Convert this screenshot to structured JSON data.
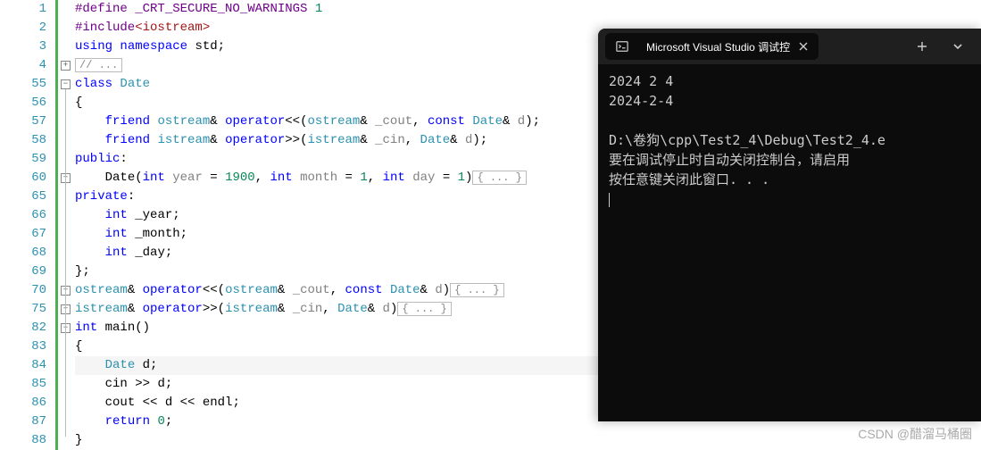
{
  "lines": [
    {
      "n": 1,
      "fold": "",
      "html": "<span class='def'>#define</span> <span class='def'>_CRT_SECURE_NO_WARNINGS</span> <span class='num'>1</span>"
    },
    {
      "n": 2,
      "fold": "",
      "html": "<span class='def'>#include</span><span class='str'>&lt;iostream&gt;</span>"
    },
    {
      "n": 3,
      "fold": "",
      "html": "<span class='kw'>using</span> <span class='kw'>namespace</span> <span class='id'>std</span>;"
    },
    {
      "n": 4,
      "fold": "plus",
      "html": "<span class='collapsed-box'>// ...</span>"
    },
    {
      "n": 55,
      "fold": "minus",
      "html": "<span class='kw'>class</span> <span class='type'>Date</span>"
    },
    {
      "n": 56,
      "fold": "",
      "html": "{"
    },
    {
      "n": 57,
      "fold": "",
      "html": "    <span class='kw'>friend</span> <span class='type'>ostream</span>&amp; <span class='kw'>operator</span>&lt;&lt;(<span class='type'>ostream</span>&amp; <span class='param'>_cout</span>, <span class='kw'>const</span> <span class='type'>Date</span>&amp; <span class='param'>d</span>);"
    },
    {
      "n": 58,
      "fold": "",
      "html": "    <span class='kw'>friend</span> <span class='type'>istream</span>&amp; <span class='kw'>operator</span>&gt;&gt;(<span class='type'>istream</span>&amp; <span class='param'>_cin</span>, <span class='type'>Date</span>&amp; <span class='param'>d</span>);"
    },
    {
      "n": 59,
      "fold": "",
      "html": "<span class='kw'>public</span>:"
    },
    {
      "n": 60,
      "fold": "plus",
      "html": "    <span class='id'>Date</span>(<span class='kw'>int</span> <span class='param'>year</span> = <span class='num'>1900</span>, <span class='kw'>int</span> <span class='param'>month</span> = <span class='num'>1</span>, <span class='kw'>int</span> <span class='param'>day</span> = <span class='num'>1</span>)<span class='collapsed-box'>{ ... }</span>"
    },
    {
      "n": 65,
      "fold": "",
      "html": "<span class='kw'>private</span>:"
    },
    {
      "n": 66,
      "fold": "",
      "html": "    <span class='kw'>int</span> <span class='id'>_year</span>;"
    },
    {
      "n": 67,
      "fold": "",
      "html": "    <span class='kw'>int</span> <span class='id'>_month</span>;"
    },
    {
      "n": 68,
      "fold": "",
      "html": "    <span class='kw'>int</span> <span class='id'>_day</span>;"
    },
    {
      "n": 69,
      "fold": "",
      "html": "};"
    },
    {
      "n": 70,
      "fold": "plus",
      "html": "<span class='type'>ostream</span>&amp; <span class='kw'>operator</span>&lt;&lt;(<span class='type'>ostream</span>&amp; <span class='param'>_cout</span>, <span class='kw'>const</span> <span class='type'>Date</span>&amp; <span class='param'>d</span>)<span class='collapsed-box'>{ ... }</span>"
    },
    {
      "n": 75,
      "fold": "plus",
      "html": "<span class='type'>istream</span>&amp; <span class='kw'>operator</span>&gt;&gt;(<span class='type'>istream</span>&amp; <span class='param'>_cin</span>, <span class='type'>Date</span>&amp; <span class='param'>d</span>)<span class='collapsed-box'>{ ... }</span>"
    },
    {
      "n": 82,
      "fold": "minus",
      "html": "<span class='kw'>int</span> <span class='id'>main</span>()"
    },
    {
      "n": 83,
      "fold": "",
      "html": "{"
    },
    {
      "n": 84,
      "fold": "",
      "hl": true,
      "html": "    <span class='type'>Date</span> <span class='id'>d</span>;"
    },
    {
      "n": 85,
      "fold": "",
      "html": "    <span class='id'>cin</span> &gt;&gt; <span class='id'>d</span>;"
    },
    {
      "n": 86,
      "fold": "",
      "html": "    <span class='id'>cout</span> &lt;&lt; <span class='id'>d</span> &lt;&lt; <span class='id'>endl</span>;"
    },
    {
      "n": 87,
      "fold": "",
      "html": "    <span class='kw'>return</span> <span class='num'>0</span>;"
    },
    {
      "n": 88,
      "fold": "",
      "html": "}"
    }
  ],
  "console": {
    "title": "Microsoft Visual Studio 调试控",
    "lines": [
      "2024 2 4",
      "2024-2-4",
      "",
      "D:\\卷狗\\cpp\\Test2_4\\Debug\\Test2_4.e",
      "要在调试停止时自动关闭控制台，请启用",
      "按任意键关闭此窗口. . ."
    ]
  },
  "watermark": "CSDN @醋溜马桶圈"
}
